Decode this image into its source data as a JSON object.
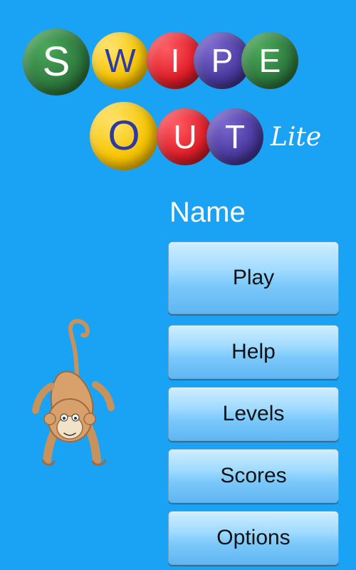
{
  "app": {
    "logo_letters_row1": [
      "S",
      "W",
      "I",
      "P",
      "E"
    ],
    "logo_letters_row2": [
      "O",
      "U",
      "T"
    ],
    "lite_label": "Lite"
  },
  "name_label": "Name",
  "menu": [
    {
      "label": "Play"
    },
    {
      "label": "Help"
    },
    {
      "label": "Levels"
    },
    {
      "label": "Scores"
    },
    {
      "label": "Options"
    }
  ],
  "colors": {
    "background": "#1aa2f5",
    "button_text": "#111111"
  },
  "illustration": {
    "icon": "monkey-icon"
  }
}
